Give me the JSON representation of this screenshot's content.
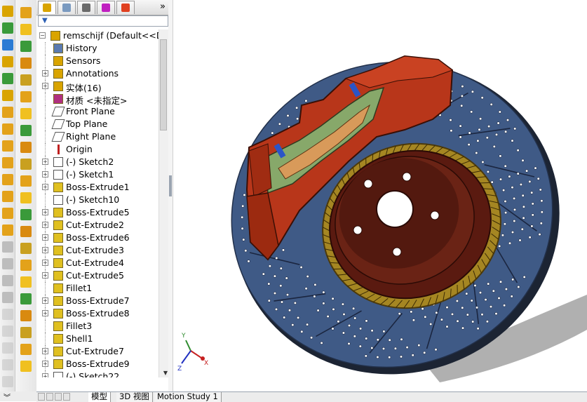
{
  "feature_manager": {
    "tabs": [
      {
        "icon": "feature-tree-icon",
        "active": true
      },
      {
        "icon": "property-manager-icon",
        "active": false
      },
      {
        "icon": "configuration-manager-icon",
        "active": false
      },
      {
        "icon": "dimxpert-icon",
        "active": false
      },
      {
        "icon": "display-manager-icon",
        "active": false
      }
    ],
    "more_symbol": "»",
    "filter_icon": "filter-icon",
    "tree": [
      {
        "label": "remschijf  (Default<<D",
        "icon": "part-icon",
        "expander": "minus",
        "indent": 0
      },
      {
        "label": "History",
        "icon": "history-icon",
        "expander": "none",
        "indent": 1
      },
      {
        "label": "Sensors",
        "icon": "sensors-icon",
        "expander": "none",
        "indent": 1
      },
      {
        "label": "Annotations",
        "icon": "annotations-icon",
        "expander": "plus",
        "indent": 1
      },
      {
        "label": "实体(16)",
        "icon": "solid-bodies-icon",
        "expander": "plus",
        "indent": 1
      },
      {
        "label": "材质 <未指定>",
        "icon": "material-icon",
        "expander": "none",
        "indent": 1
      },
      {
        "label": "Front Plane",
        "icon": "plane-icon",
        "expander": "none",
        "indent": 1
      },
      {
        "label": "Top Plane",
        "icon": "plane-icon",
        "expander": "none",
        "indent": 1
      },
      {
        "label": "Right Plane",
        "icon": "plane-icon",
        "expander": "none",
        "indent": 1
      },
      {
        "label": "Origin",
        "icon": "origin-icon",
        "expander": "none",
        "indent": 1
      },
      {
        "label": "(-) Sketch2",
        "icon": "sketch-icon",
        "expander": "plus",
        "indent": 1
      },
      {
        "label": "(-) Sketch1",
        "icon": "sketch-icon",
        "expander": "plus",
        "indent": 1
      },
      {
        "label": "Boss-Extrude1",
        "icon": "boss-extrude-icon",
        "expander": "plus",
        "indent": 1
      },
      {
        "label": "(-) Sketch10",
        "icon": "sketch-icon",
        "expander": "none",
        "indent": 1
      },
      {
        "label": "Boss-Extrude5",
        "icon": "boss-extrude-icon",
        "expander": "plus",
        "indent": 1
      },
      {
        "label": "Cut-Extrude2",
        "icon": "cut-extrude-icon",
        "expander": "plus",
        "indent": 1
      },
      {
        "label": "Boss-Extrude6",
        "icon": "boss-extrude-icon",
        "expander": "plus",
        "indent": 1
      },
      {
        "label": "Cut-Extrude3",
        "icon": "cut-extrude-icon",
        "expander": "plus",
        "indent": 1
      },
      {
        "label": "Cut-Extrude4",
        "icon": "cut-extrude-icon",
        "expander": "plus",
        "indent": 1
      },
      {
        "label": "Cut-Extrude5",
        "icon": "cut-extrude-icon",
        "expander": "plus",
        "indent": 1
      },
      {
        "label": "Fillet1",
        "icon": "fillet-icon",
        "expander": "none",
        "indent": 1
      },
      {
        "label": "Boss-Extrude7",
        "icon": "boss-extrude-icon",
        "expander": "plus",
        "indent": 1
      },
      {
        "label": "Boss-Extrude8",
        "icon": "boss-extrude-icon",
        "expander": "plus",
        "indent": 1
      },
      {
        "label": "Fillet3",
        "icon": "fillet-icon",
        "expander": "none",
        "indent": 1
      },
      {
        "label": "Shell1",
        "icon": "shell-icon",
        "expander": "none",
        "indent": 1
      },
      {
        "label": "Cut-Extrude7",
        "icon": "cut-extrude-icon",
        "expander": "plus",
        "indent": 1
      },
      {
        "label": "Boss-Extrude9",
        "icon": "boss-extrude-icon",
        "expander": "plus",
        "indent": 1
      },
      {
        "label": "(-) Sketch22",
        "icon": "sketch-icon",
        "expander": "plus",
        "indent": 1
      }
    ]
  },
  "bottom_tabs": [
    {
      "label": "模型",
      "active": true
    },
    {
      "label": "3D 视图",
      "active": false
    },
    {
      "label": "Motion Study 1",
      "active": false
    }
  ],
  "triad": {
    "x_label": "X",
    "y_label": "Y",
    "z_label": "Z"
  },
  "colors": {
    "caliper": "#b8361a",
    "disc": "#3f5a86",
    "hat": "#5a1a10"
  }
}
